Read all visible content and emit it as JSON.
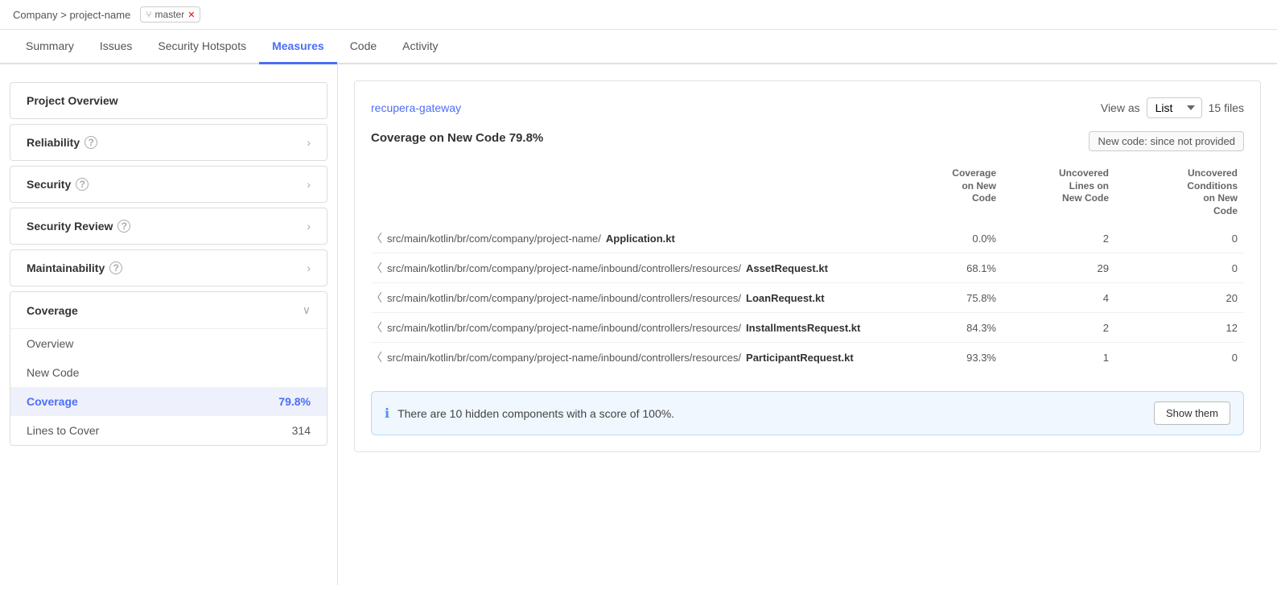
{
  "breadcrumb": {
    "text": "Company > project-name",
    "branch": "master"
  },
  "nav": {
    "tabs": [
      {
        "id": "summary",
        "label": "Summary",
        "active": false
      },
      {
        "id": "issues",
        "label": "Issues",
        "active": false
      },
      {
        "id": "security-hotspots",
        "label": "Security Hotspots",
        "active": false
      },
      {
        "id": "measures",
        "label": "Measures",
        "active": true
      },
      {
        "id": "code",
        "label": "Code",
        "active": false
      },
      {
        "id": "activity",
        "label": "Activity",
        "active": false
      }
    ]
  },
  "sidebar": {
    "items": [
      {
        "id": "project-overview",
        "label": "Project Overview",
        "hasHelp": false,
        "hasChevron": false
      },
      {
        "id": "reliability",
        "label": "Reliability",
        "hasHelp": true,
        "hasChevron": true
      },
      {
        "id": "security",
        "label": "Security",
        "hasHelp": true,
        "hasChevron": true
      },
      {
        "id": "security-review",
        "label": "Security Review",
        "hasHelp": true,
        "hasChevron": true
      },
      {
        "id": "maintainability",
        "label": "Maintainability",
        "hasHelp": true,
        "hasChevron": true
      }
    ],
    "coverage": {
      "label": "Coverage",
      "subItems": [
        {
          "id": "overview",
          "label": "Overview",
          "active": false,
          "value": ""
        },
        {
          "id": "new-code",
          "label": "New Code",
          "active": false,
          "value": ""
        },
        {
          "id": "coverage",
          "label": "Coverage",
          "active": true,
          "value": "79.8%"
        },
        {
          "id": "lines-to-cover",
          "label": "Lines to Cover",
          "active": false,
          "value": "314"
        }
      ]
    }
  },
  "content": {
    "path": "recupera-gateway",
    "viewAs": {
      "label": "View as",
      "selected": "List",
      "options": [
        "List",
        "Tree"
      ]
    },
    "filesCount": "15 files",
    "coverageHeadline": "Coverage on New Code",
    "coveragePct": "79.8%",
    "newCodeBadge": "New code: since not provided",
    "columns": {
      "coverage": "Coverage on New Code",
      "uncoveredLines": "Uncovered Lines on New Code",
      "uncoveredConditions": "Uncovered Conditions on New Code"
    },
    "files": [
      {
        "path": "src/main/kotlin/br/com/company/project-name/",
        "filename": "Application.kt",
        "coverage": "0.0%",
        "uncoveredLines": "2",
        "uncoveredConditions": "0"
      },
      {
        "path": "src/main/kotlin/br/com/company/project-name/inbound/controllers/resources/",
        "filename": "AssetRequest.kt",
        "coverage": "68.1%",
        "uncoveredLines": "29",
        "uncoveredConditions": "0"
      },
      {
        "path": "src/main/kotlin/br/com/company/project-name/inbound/controllers/resources/",
        "filename": "LoanRequest.kt",
        "coverage": "75.8%",
        "uncoveredLines": "4",
        "uncoveredConditions": "20"
      },
      {
        "path": "src/main/kotlin/br/com/company/project-name/inbound/controllers/resources/",
        "filename": "InstallmentsRequest.kt",
        "coverage": "84.3%",
        "uncoveredLines": "2",
        "uncoveredConditions": "12"
      },
      {
        "path": "src/main/kotlin/br/com/company/project-name/inbound/controllers/resources/",
        "filename": "ParticipantRequest.kt",
        "coverage": "93.3%",
        "uncoveredLines": "1",
        "uncoveredConditions": "0"
      }
    ],
    "hiddenBanner": {
      "text": "There are 10 hidden components with a score of 100%.",
      "buttonLabel": "Show them"
    }
  }
}
